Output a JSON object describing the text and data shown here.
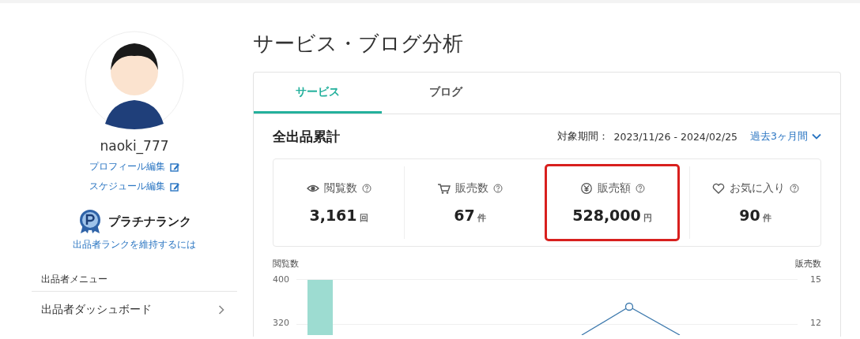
{
  "sidebar": {
    "username": "naoki_777",
    "edit_links": [
      "プロフィール編集",
      "スケジュール編集"
    ],
    "rank": {
      "label": "プラチナランク",
      "link": "出品者ランクを維持するには"
    },
    "menu_heading": "出品者メニュー",
    "menu_items": [
      {
        "label": "出品者ダッシュボード"
      }
    ]
  },
  "main": {
    "title": "サービス・ブログ分析",
    "tabs": [
      {
        "label": "サービス",
        "selected": true
      },
      {
        "label": "ブログ",
        "selected": false
      }
    ],
    "section_title": "全出品累計",
    "period_label": "対象期間：",
    "period": "2023/11/26 - 2024/02/25",
    "range_dropdown": "過去3ヶ月間",
    "stats": [
      {
        "kind": "views",
        "label": "閲覧数",
        "value": "3,161",
        "unit": "回",
        "highlighted": false
      },
      {
        "kind": "sales",
        "label": "販売数",
        "value": "67",
        "unit": "件",
        "highlighted": false
      },
      {
        "kind": "revenue",
        "label": "販売額",
        "value": "528,000",
        "unit": "円",
        "highlighted": true
      },
      {
        "kind": "favorites",
        "label": "お気に入り",
        "value": "90",
        "unit": "件",
        "highlighted": false
      }
    ],
    "chart": {
      "left_axis_title": "閲覧数",
      "right_axis_title": "販売数",
      "left_ticks": [
        "400",
        "320"
      ],
      "right_ticks": [
        "15",
        "12"
      ]
    }
  }
}
